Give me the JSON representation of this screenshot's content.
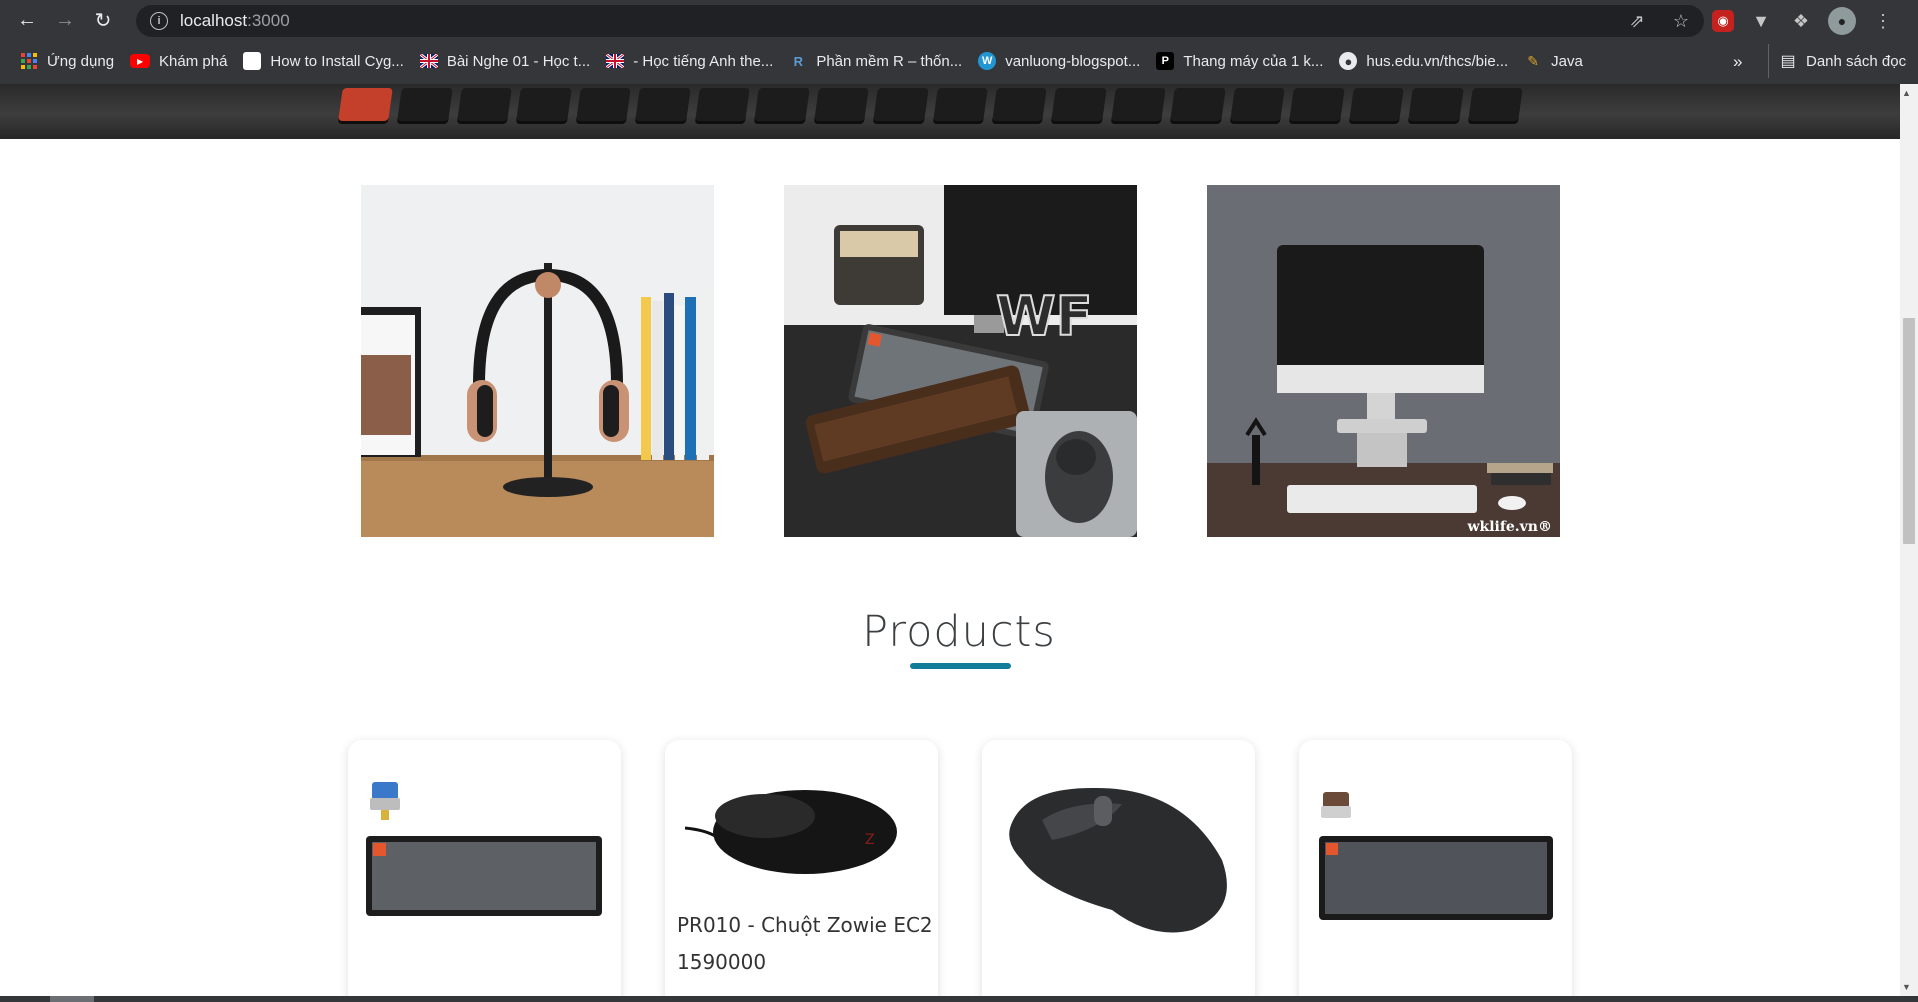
{
  "browser": {
    "url_host": "localhost",
    "url_port": ":3000",
    "bookmarks": [
      {
        "label": "Ứng dụng",
        "icon": "apps-grid-icon"
      },
      {
        "label": "Khám phá",
        "icon": "youtube-icon"
      },
      {
        "label": "How to Install Cyg...",
        "icon": "blank-page-icon"
      },
      {
        "label": "Bài Nghe 01 - Học t...",
        "icon": "uk-flag-icon"
      },
      {
        "label": "- Học tiếng Anh the...",
        "icon": "uk-flag-icon"
      },
      {
        "label": "Phần mềm R – thốn...",
        "icon": "r-logo-icon"
      },
      {
        "label": "vanluong-blogspot...",
        "icon": "wordpress-icon"
      },
      {
        "label": "Thang máy của 1 k...",
        "icon": "p-square-icon"
      },
      {
        "label": "hus.edu.vn/thcs/bie...",
        "icon": "globe-icon"
      },
      {
        "label": "Java",
        "icon": "java-icon"
      }
    ],
    "more_label": "»",
    "reading_list_label": "Danh sách đọc"
  },
  "page": {
    "gallery_watermark": "wklife.vn®",
    "gallery_keycap_text": "WF",
    "section_title": "Products",
    "products": [
      {
        "name": "",
        "price": ""
      },
      {
        "name": "PR010 - Chuột Zowie EC2",
        "price": "1590000"
      },
      {
        "name": "",
        "price": ""
      },
      {
        "name": "",
        "price": ""
      }
    ]
  },
  "colors": {
    "accent": "#137d99",
    "chrome_bg": "#35363a",
    "omnibox_bg": "#202124"
  }
}
